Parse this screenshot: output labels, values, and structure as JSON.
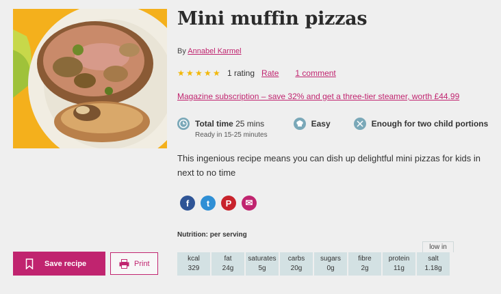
{
  "recipe": {
    "title": "Mini muffin pizzas",
    "byline_prefix": "By",
    "author": "Annabel Karmel",
    "rating_text": "1 rating",
    "rate_link": "Rate",
    "comments_link": "1 comment",
    "star_count": 5,
    "promo_link": "Magazine subscription – save 32% and get a three-tier steamer, worth £44.99",
    "description": "This ingenious recipe means you can dish up delightful mini pizzas for kids in next to no time"
  },
  "meta": {
    "total_time_label": "Total time",
    "total_time_value": "25 mins",
    "ready_text": "Ready in 15-25 minutes",
    "difficulty": "Easy",
    "serves": "Enough for two child portions",
    "icons": [
      "clock-icon",
      "chef-hat-icon",
      "cutlery-icon"
    ]
  },
  "social": {
    "facebook": "f",
    "twitter": "t",
    "pinterest": "P",
    "email": "✉"
  },
  "nutrition": {
    "label": "Nutrition: per serving",
    "low_in": "low in",
    "items": [
      {
        "name": "kcal",
        "value": "329"
      },
      {
        "name": "fat",
        "value": "24g"
      },
      {
        "name": "saturates",
        "value": "5g"
      },
      {
        "name": "carbs",
        "value": "20g"
      },
      {
        "name": "sugars",
        "value": "0g"
      },
      {
        "name": "fibre",
        "value": "2g"
      },
      {
        "name": "protein",
        "value": "11g"
      },
      {
        "name": "salt",
        "value": "1.18g"
      }
    ]
  },
  "actions": {
    "save_label": "Save recipe",
    "print_label": "Print"
  },
  "colors": {
    "brand": "#c0246f",
    "star": "#f2b705",
    "meta_icon": "#7aa8b8",
    "nutrition_cell": "#d3e1e3"
  }
}
